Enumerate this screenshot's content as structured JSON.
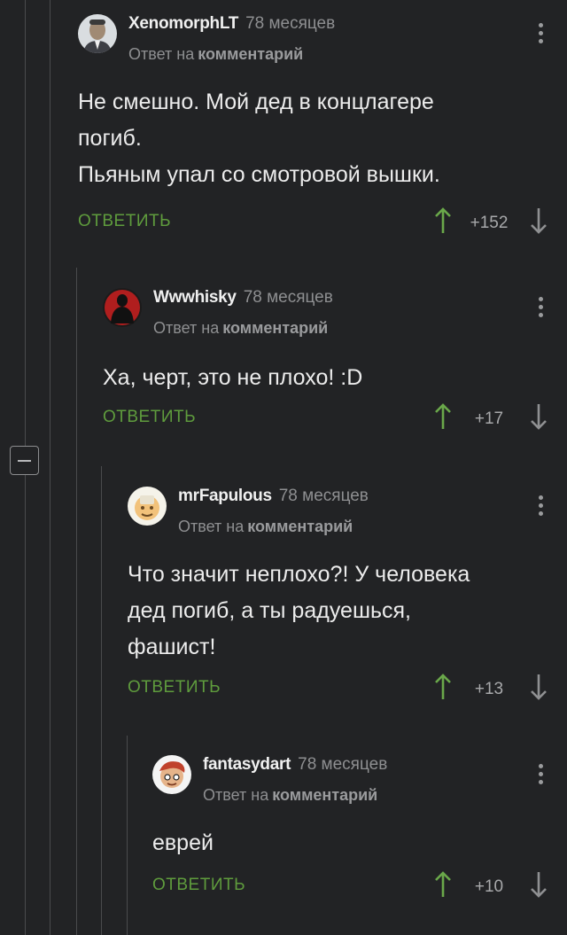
{
  "comments": [
    {
      "author": "XenomorphLT",
      "time": "78 месяцев",
      "reply_prefix": "Ответ на",
      "reply_link": "комментарий",
      "lines": [
        "Не смешно. Мой дед в концлагере",
        "погиб.",
        "Пьяным упал со смотровой вышки."
      ],
      "reply_label": "ОТВЕТИТЬ",
      "rating": "+152"
    },
    {
      "author": "Wwwhisky",
      "time": "78 месяцев",
      "reply_prefix": "Ответ на",
      "reply_link": "комментарий",
      "lines": [
        "Ха, черт, это не плохо! :D"
      ],
      "reply_label": "ОТВЕТИТЬ",
      "rating": "+17"
    },
    {
      "author": "mrFapulous",
      "time": "78 месяцев",
      "reply_prefix": "Ответ на",
      "reply_link": "комментарий",
      "lines": [
        "Что значит неплохо?! У человека",
        "дед погиб, а ты радуешься,",
        "фашист!"
      ],
      "reply_label": "ОТВЕТИТЬ",
      "rating": "+13"
    },
    {
      "author": "fantasydart",
      "time": "78 месяцев",
      "reply_prefix": "Ответ на",
      "reply_link": "комментарий",
      "lines": [
        "еврей"
      ],
      "reply_label": "ОТВЕТИТЬ",
      "rating": "+10"
    }
  ],
  "colors": {
    "background": "#222325",
    "reply_link": "#5f9c3d",
    "thread_line": "#4a4b4d"
  }
}
